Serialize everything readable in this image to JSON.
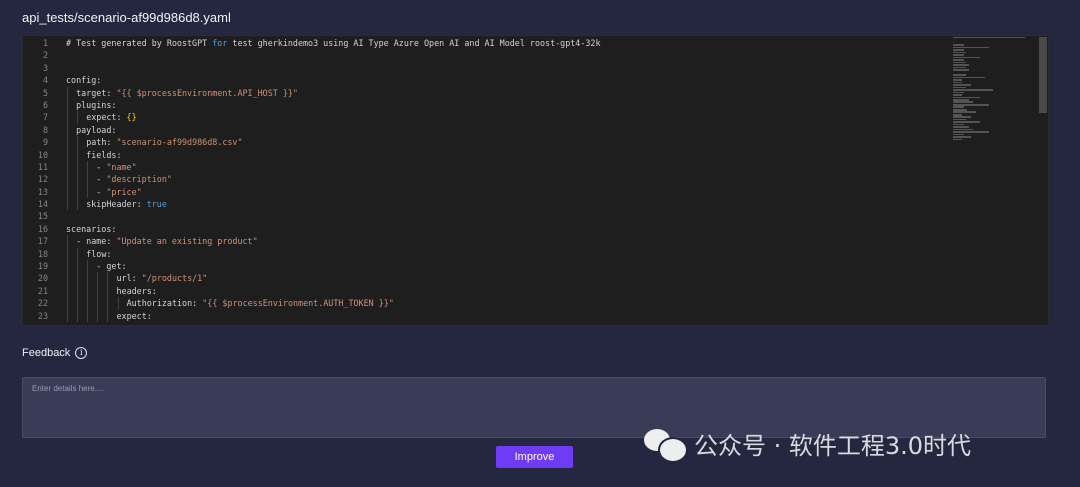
{
  "file": {
    "name": "api_tests/scenario-af99d986d8.yaml"
  },
  "editor": {
    "lines": [
      {
        "n": "1",
        "indent": 0,
        "tokens": [
          {
            "t": "# Test generated by RoostGPT ",
            "c": "t-comment"
          },
          {
            "t": "for",
            "c": "t-kw"
          },
          {
            "t": " test gherkindemo3 using AI Type Azure Open AI and AI Model roost-gpt4-32k",
            "c": "t-comment"
          }
        ]
      },
      {
        "n": "2",
        "indent": 0,
        "tokens": []
      },
      {
        "n": "3",
        "indent": 0,
        "tokens": []
      },
      {
        "n": "4",
        "indent": 0,
        "tokens": [
          {
            "t": "config:",
            "c": "t-key"
          }
        ]
      },
      {
        "n": "5",
        "indent": 1,
        "tokens": [
          {
            "t": "target: ",
            "c": "t-key"
          },
          {
            "t": "\"{{ $processEnvironment.API_HOST }}\"",
            "c": "t-str"
          }
        ]
      },
      {
        "n": "6",
        "indent": 1,
        "tokens": [
          {
            "t": "plugins:",
            "c": "t-key"
          }
        ]
      },
      {
        "n": "7",
        "indent": 2,
        "tokens": [
          {
            "t": "expect: ",
            "c": "t-key"
          },
          {
            "t": "{}",
            "c": "t-brace"
          }
        ]
      },
      {
        "n": "8",
        "indent": 1,
        "tokens": [
          {
            "t": "payload:",
            "c": "t-key"
          }
        ]
      },
      {
        "n": "9",
        "indent": 2,
        "tokens": [
          {
            "t": "path: ",
            "c": "t-key"
          },
          {
            "t": "\"scenario-af99d986d8.csv\"",
            "c": "t-str"
          }
        ]
      },
      {
        "n": "10",
        "indent": 2,
        "tokens": [
          {
            "t": "fields:",
            "c": "t-key"
          }
        ]
      },
      {
        "n": "11",
        "indent": 3,
        "tokens": [
          {
            "t": "- ",
            "c": "t-key"
          },
          {
            "t": "\"name\"",
            "c": "t-str"
          }
        ]
      },
      {
        "n": "12",
        "indent": 3,
        "tokens": [
          {
            "t": "- ",
            "c": "t-key"
          },
          {
            "t": "\"description\"",
            "c": "t-str"
          }
        ]
      },
      {
        "n": "13",
        "indent": 3,
        "tokens": [
          {
            "t": "- ",
            "c": "t-key"
          },
          {
            "t": "\"price\"",
            "c": "t-str"
          }
        ]
      },
      {
        "n": "14",
        "indent": 2,
        "tokens": [
          {
            "t": "skipHeader: ",
            "c": "t-key"
          },
          {
            "t": "true",
            "c": "t-kw"
          }
        ]
      },
      {
        "n": "15",
        "indent": 0,
        "tokens": []
      },
      {
        "n": "16",
        "indent": 0,
        "tokens": [
          {
            "t": "scenarios:",
            "c": "t-key"
          }
        ]
      },
      {
        "n": "17",
        "indent": 1,
        "tokens": [
          {
            "t": "- name: ",
            "c": "t-key"
          },
          {
            "t": "\"Update an existing product\"",
            "c": "t-str"
          }
        ]
      },
      {
        "n": "18",
        "indent": 2,
        "tokens": [
          {
            "t": "flow:",
            "c": "t-key"
          }
        ]
      },
      {
        "n": "19",
        "indent": 3,
        "tokens": [
          {
            "t": "- get:",
            "c": "t-key"
          }
        ]
      },
      {
        "n": "20",
        "indent": 5,
        "tokens": [
          {
            "t": "url: ",
            "c": "t-key"
          },
          {
            "t": "\"/products/1\"",
            "c": "t-str"
          }
        ]
      },
      {
        "n": "21",
        "indent": 5,
        "tokens": [
          {
            "t": "headers:",
            "c": "t-key"
          }
        ]
      },
      {
        "n": "22",
        "indent": 6,
        "tokens": [
          {
            "t": "Authorization: ",
            "c": "t-key"
          },
          {
            "t": "\"{{ $processEnvironment.AUTH_TOKEN }}\"",
            "c": "t-str"
          }
        ]
      },
      {
        "n": "23",
        "indent": 5,
        "tokens": [
          {
            "t": "expect:",
            "c": "t-key"
          }
        ]
      }
    ]
  },
  "feedback": {
    "label": "Feedback",
    "info_icon": "info-circle-icon",
    "placeholder": "Enter details here....",
    "value": ""
  },
  "actions": {
    "improve_label": "Improve"
  },
  "watermark": {
    "text": "公众号 · 软件工程3.0时代",
    "logo_icon": "wechat-logo-icon"
  },
  "colors": {
    "background": "#252740",
    "editor_bg": "#1e1e1e",
    "string": "#ce9178",
    "keyword": "#569cd6",
    "brace": "#ffd700",
    "accent_button": "#6f3bf5",
    "input_bg": "#3a3c57"
  }
}
